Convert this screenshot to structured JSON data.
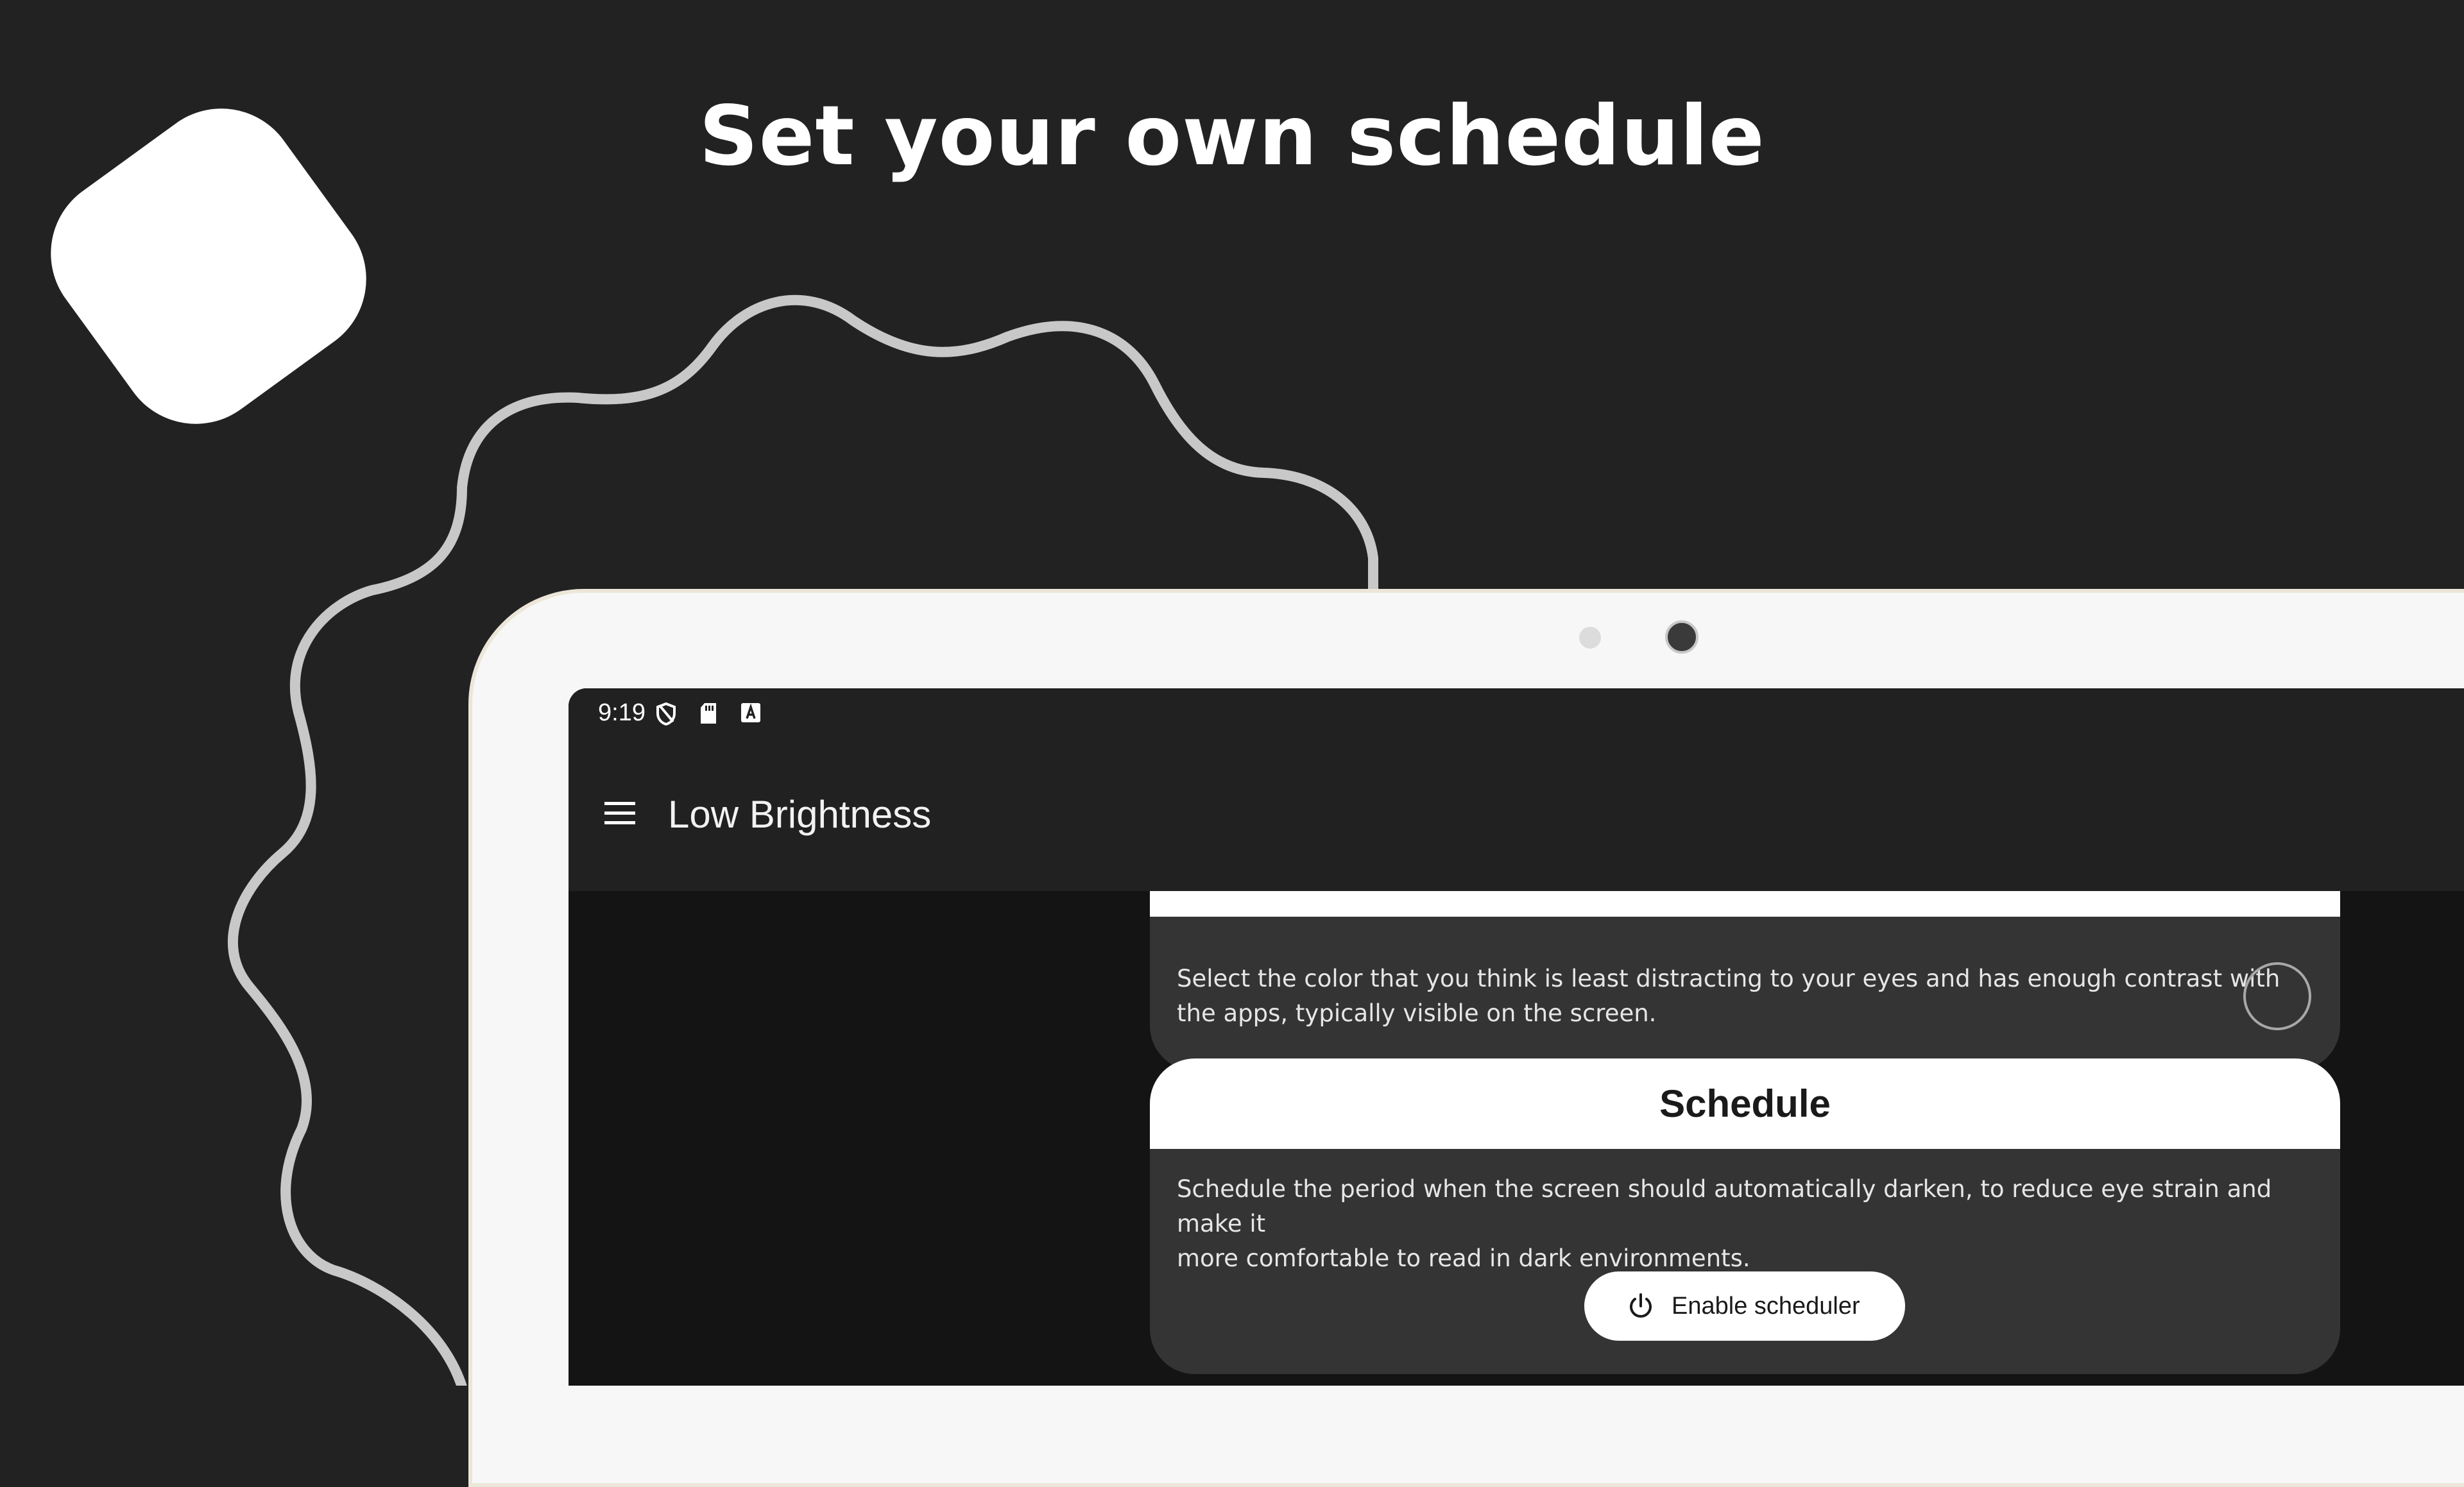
{
  "headline": "Set your own schedule",
  "status_bar": {
    "time": "9:19",
    "icons": [
      "vpn-shield-icon",
      "sd-card-icon",
      "keyboard-a-icon"
    ]
  },
  "app_bar": {
    "menu_icon": "hamburger-menu-icon",
    "title": "Low Brightness"
  },
  "color_card": {
    "description": "Select the color that you think is least distracting to your eyes and has enough contrast with the apps, typically visible on the screen.",
    "line1": "Select the color that you think is least distracting to your eyes and has enough contrast with",
    "line2": "the apps, typically visible on the screen.",
    "selected_color": "#343434"
  },
  "schedule_card": {
    "title": "Schedule",
    "line1": "Schedule the period when the screen should automatically darken, to reduce eye strain and make it",
    "line2": "more comfortable to read in dark environments.",
    "button_label": "Enable scheduler",
    "button_icon": "power-icon"
  },
  "colors": {
    "background": "#222222",
    "card": "#343434",
    "card_header": "#ffffff",
    "accent_text": "#ffffff"
  }
}
